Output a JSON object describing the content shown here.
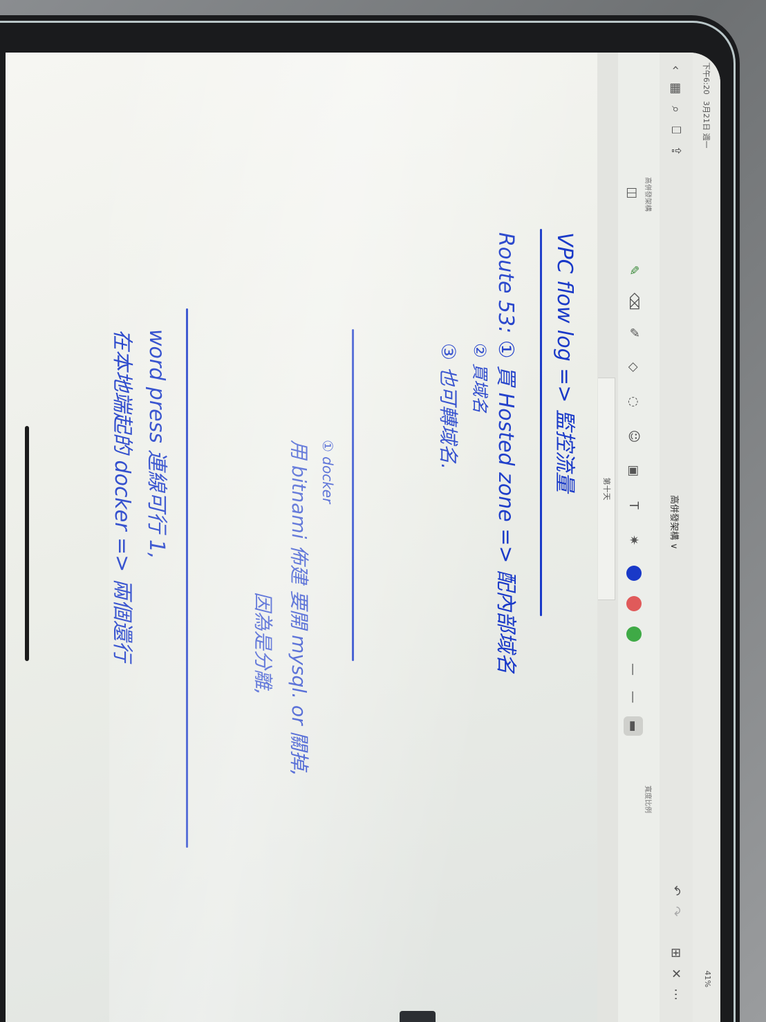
{
  "status_bar": {
    "time": "下午6:20",
    "date": "3月21日 週一",
    "battery": "41%"
  },
  "top_bar": {
    "notebook_title": "高併發架構",
    "dropdown_glyph": "∨",
    "left_label": "高併發架構",
    "right_label": "寬度比例"
  },
  "tabs": [
    {
      "label": "第十天"
    }
  ],
  "toolbar": {
    "colors": [
      "#1939c8",
      "#e05a5a",
      "#3faa46"
    ],
    "icons": [
      "pen-icon",
      "eraser-icon",
      "highlighter-icon",
      "shapes-icon",
      "lasso-icon",
      "sticker-icon",
      "image-icon",
      "text-icon",
      "laser-icon"
    ]
  },
  "note": {
    "line1": "VPC flow log => 監控流量",
    "line2": "Route 53: ① 買 Hosted zone => 配內部域名",
    "line2_sub": "② 買域名",
    "line3": "③ 也可轉域名.",
    "line4_mark": "① docker",
    "line4": "用 bitnami 佈建 要開 mysql. or 關掉,",
    "line5": "因為是分離,",
    "line6": "word press 連線可行 1,",
    "line7": "在本地端起的 docker => 兩個還行"
  }
}
